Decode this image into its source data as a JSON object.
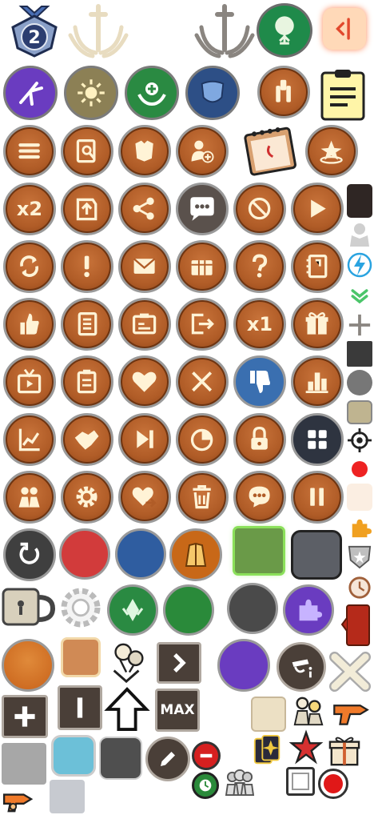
{
  "labels": {
    "badge_level": "2",
    "speed_x2": "x2",
    "speed_x1": "x1",
    "max_label": "MAX"
  },
  "colors": {
    "orb_orange": "#b05c27",
    "cream": "#fff3d6",
    "green_tree": "#1f8a4a",
    "purple": "#6a3cc0",
    "blue": "#3a6fb0",
    "red": "#d23b3b",
    "dark_gray": "#3f3f3f",
    "slate": "#5c5f66",
    "lime": "#7ad04a"
  }
}
